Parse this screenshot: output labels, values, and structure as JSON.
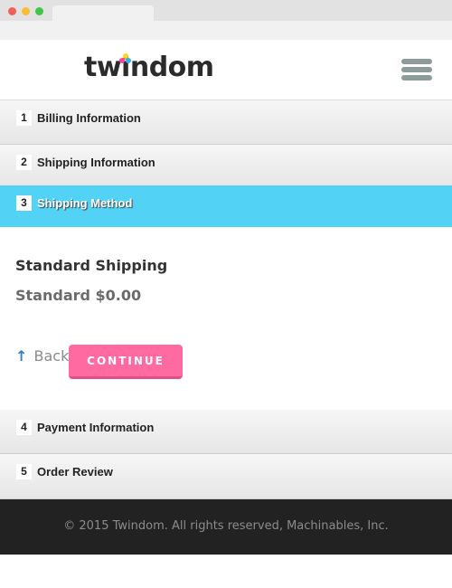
{
  "header": {
    "logo_text": "twindom",
    "logo_dot_colors": [
      "#ffd21f",
      "#ff3fa4",
      "#2ab6ea"
    ],
    "menu_icon": "hamburger-menu-icon"
  },
  "steps": [
    {
      "number": "1",
      "label": "Billing Information",
      "active": false
    },
    {
      "number": "2",
      "label": "Shipping Information",
      "active": false
    },
    {
      "number": "3",
      "label": "Shipping Method",
      "active": true
    },
    {
      "number": "4",
      "label": "Payment Information",
      "active": false
    },
    {
      "number": "5",
      "label": "Order Review",
      "active": false
    }
  ],
  "shipping_method": {
    "title": "Standard Shipping",
    "option": "Standard $0.00"
  },
  "actions": {
    "back_arrow": "↑",
    "back_label": "Back",
    "continue_label": "CONTINUE"
  },
  "footer": {
    "copyright": "© 2015 Twindom. All rights reserved, Machinables, Inc."
  },
  "colors": {
    "active_step": "#52d3f5",
    "continue_button": "#ff6aa0",
    "footer_bg": "#222222"
  }
}
